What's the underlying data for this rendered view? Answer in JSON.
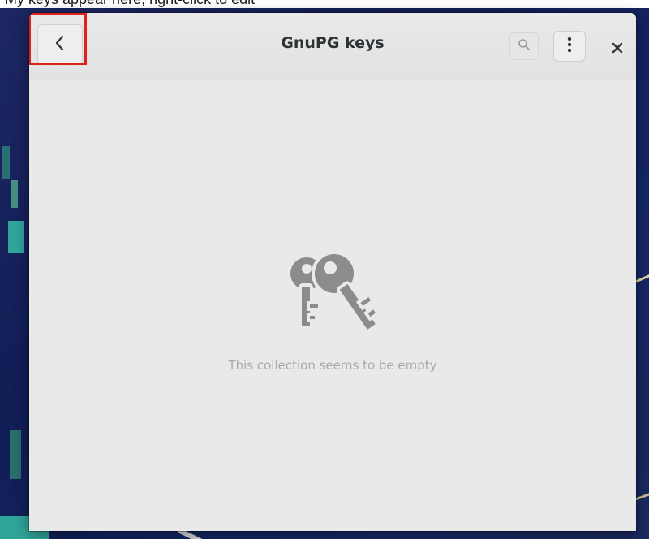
{
  "caption_fragment": "My keys appear here; right-click to edit",
  "window": {
    "title": "GnuPG keys",
    "empty_state": {
      "icon": "keys-icon",
      "message": "This collection seems to be empty"
    }
  },
  "headerbar": {
    "back_icon": "chevron-left-icon",
    "search_icon": "search-icon",
    "menu_icon": "vertical-ellipsis-icon",
    "close_icon": "close-icon",
    "back_glyph": "‹",
    "menu_glyph": "⋮",
    "close_glyph": "×"
  },
  "colors": {
    "highlight": "#e0201b",
    "window_bg": "#e9e9e9",
    "headerbar_bg": "#e4e4e4",
    "empty_icon": "#8c8c8c",
    "empty_text": "#a9a9a9",
    "desktop_bg": "#142066",
    "desktop_accent": "#2fa59a"
  }
}
